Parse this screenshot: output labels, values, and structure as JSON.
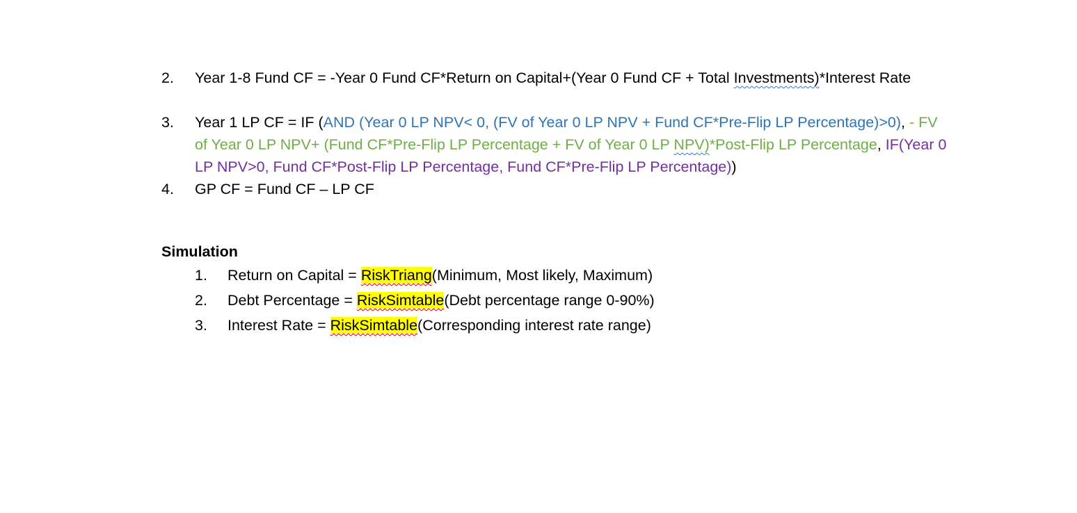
{
  "formulas": [
    {
      "number": "2.",
      "segments": [
        {
          "text": "Year 1-8 Fund CF = -Year 0 Fund CF*Return on Capital+(Year 0 Fund CF + Total ",
          "style": "black"
        },
        {
          "text": "Investments)",
          "style": "black-wavy"
        },
        {
          "text": "*Interest Rate",
          "style": "black"
        }
      ]
    },
    {
      "number": "3.",
      "segments": [
        {
          "text": "Year 1 LP CF = IF (",
          "style": "black"
        },
        {
          "text": "AND (Year 0 LP NPV< 0, (FV of Year 0 LP NPV + Fund CF*Pre-Flip LP Percentage)>0)",
          "style": "blue"
        },
        {
          "text": ", ",
          "style": "black"
        },
        {
          "text": "- FV of Year 0 LP NPV+ (Fund CF*Pre-Flip LP Percentage + FV of Year 0 LP ",
          "style": "green"
        },
        {
          "text": "NPV)",
          "style": "green-wavy"
        },
        {
          "text": "*Post-Flip LP Percentage",
          "style": "green"
        },
        {
          "text": ", ",
          "style": "black"
        },
        {
          "text": "IF(Year 0 LP NPV>0, Fund CF*Post-Flip LP Percentage, Fund CF*Pre-Flip LP Percentage)",
          "style": "purple"
        },
        {
          "text": ")",
          "style": "black"
        }
      ]
    },
    {
      "number": "4.",
      "segments": [
        {
          "text": "GP CF = Fund CF – LP CF",
          "style": "black"
        }
      ]
    }
  ],
  "simulation": {
    "heading": "Simulation",
    "items": [
      {
        "number": "1.",
        "before": "Return on Capital = ",
        "function": "RiskTriang",
        "after": "(Minimum, Most likely, Maximum)"
      },
      {
        "number": "2.",
        "before": "Debt Percentage = ",
        "function": "RiskSimtable",
        "after": "(Debt percentage range 0-90%)"
      },
      {
        "number": "3.",
        "before": "Interest Rate = ",
        "function": "RiskSimtable",
        "after": "(Corresponding interest rate range)"
      }
    ]
  }
}
